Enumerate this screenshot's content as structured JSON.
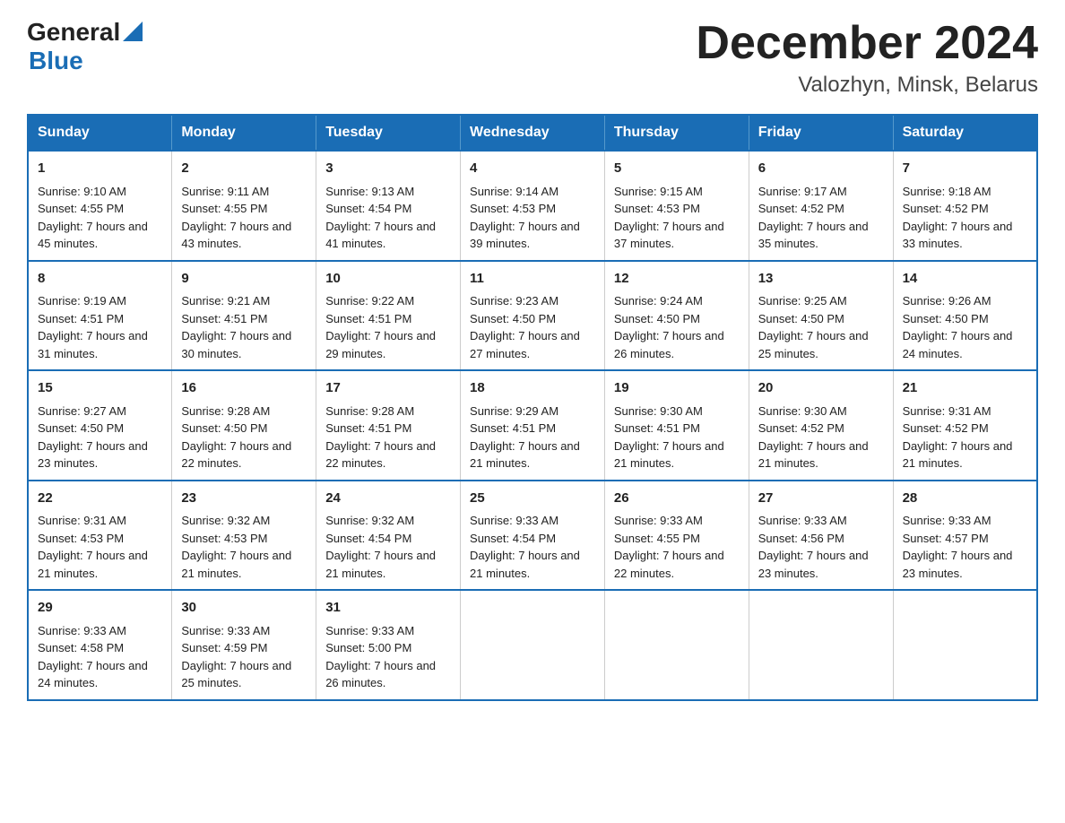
{
  "header": {
    "logo_general": "General",
    "logo_blue": "Blue",
    "month_title": "December 2024",
    "location": "Valozhyn, Minsk, Belarus"
  },
  "days_of_week": [
    "Sunday",
    "Monday",
    "Tuesday",
    "Wednesday",
    "Thursday",
    "Friday",
    "Saturday"
  ],
  "weeks": [
    [
      {
        "day": "1",
        "sunrise": "9:10 AM",
        "sunset": "4:55 PM",
        "daylight": "7 hours and 45 minutes."
      },
      {
        "day": "2",
        "sunrise": "9:11 AM",
        "sunset": "4:55 PM",
        "daylight": "7 hours and 43 minutes."
      },
      {
        "day": "3",
        "sunrise": "9:13 AM",
        "sunset": "4:54 PM",
        "daylight": "7 hours and 41 minutes."
      },
      {
        "day": "4",
        "sunrise": "9:14 AM",
        "sunset": "4:53 PM",
        "daylight": "7 hours and 39 minutes."
      },
      {
        "day": "5",
        "sunrise": "9:15 AM",
        "sunset": "4:53 PM",
        "daylight": "7 hours and 37 minutes."
      },
      {
        "day": "6",
        "sunrise": "9:17 AM",
        "sunset": "4:52 PM",
        "daylight": "7 hours and 35 minutes."
      },
      {
        "day": "7",
        "sunrise": "9:18 AM",
        "sunset": "4:52 PM",
        "daylight": "7 hours and 33 minutes."
      }
    ],
    [
      {
        "day": "8",
        "sunrise": "9:19 AM",
        "sunset": "4:51 PM",
        "daylight": "7 hours and 31 minutes."
      },
      {
        "day": "9",
        "sunrise": "9:21 AM",
        "sunset": "4:51 PM",
        "daylight": "7 hours and 30 minutes."
      },
      {
        "day": "10",
        "sunrise": "9:22 AM",
        "sunset": "4:51 PM",
        "daylight": "7 hours and 29 minutes."
      },
      {
        "day": "11",
        "sunrise": "9:23 AM",
        "sunset": "4:50 PM",
        "daylight": "7 hours and 27 minutes."
      },
      {
        "day": "12",
        "sunrise": "9:24 AM",
        "sunset": "4:50 PM",
        "daylight": "7 hours and 26 minutes."
      },
      {
        "day": "13",
        "sunrise": "9:25 AM",
        "sunset": "4:50 PM",
        "daylight": "7 hours and 25 minutes."
      },
      {
        "day": "14",
        "sunrise": "9:26 AM",
        "sunset": "4:50 PM",
        "daylight": "7 hours and 24 minutes."
      }
    ],
    [
      {
        "day": "15",
        "sunrise": "9:27 AM",
        "sunset": "4:50 PM",
        "daylight": "7 hours and 23 minutes."
      },
      {
        "day": "16",
        "sunrise": "9:28 AM",
        "sunset": "4:50 PM",
        "daylight": "7 hours and 22 minutes."
      },
      {
        "day": "17",
        "sunrise": "9:28 AM",
        "sunset": "4:51 PM",
        "daylight": "7 hours and 22 minutes."
      },
      {
        "day": "18",
        "sunrise": "9:29 AM",
        "sunset": "4:51 PM",
        "daylight": "7 hours and 21 minutes."
      },
      {
        "day": "19",
        "sunrise": "9:30 AM",
        "sunset": "4:51 PM",
        "daylight": "7 hours and 21 minutes."
      },
      {
        "day": "20",
        "sunrise": "9:30 AM",
        "sunset": "4:52 PM",
        "daylight": "7 hours and 21 minutes."
      },
      {
        "day": "21",
        "sunrise": "9:31 AM",
        "sunset": "4:52 PM",
        "daylight": "7 hours and 21 minutes."
      }
    ],
    [
      {
        "day": "22",
        "sunrise": "9:31 AM",
        "sunset": "4:53 PM",
        "daylight": "7 hours and 21 minutes."
      },
      {
        "day": "23",
        "sunrise": "9:32 AM",
        "sunset": "4:53 PM",
        "daylight": "7 hours and 21 minutes."
      },
      {
        "day": "24",
        "sunrise": "9:32 AM",
        "sunset": "4:54 PM",
        "daylight": "7 hours and 21 minutes."
      },
      {
        "day": "25",
        "sunrise": "9:33 AM",
        "sunset": "4:54 PM",
        "daylight": "7 hours and 21 minutes."
      },
      {
        "day": "26",
        "sunrise": "9:33 AM",
        "sunset": "4:55 PM",
        "daylight": "7 hours and 22 minutes."
      },
      {
        "day": "27",
        "sunrise": "9:33 AM",
        "sunset": "4:56 PM",
        "daylight": "7 hours and 23 minutes."
      },
      {
        "day": "28",
        "sunrise": "9:33 AM",
        "sunset": "4:57 PM",
        "daylight": "7 hours and 23 minutes."
      }
    ],
    [
      {
        "day": "29",
        "sunrise": "9:33 AM",
        "sunset": "4:58 PM",
        "daylight": "7 hours and 24 minutes."
      },
      {
        "day": "30",
        "sunrise": "9:33 AM",
        "sunset": "4:59 PM",
        "daylight": "7 hours and 25 minutes."
      },
      {
        "day": "31",
        "sunrise": "9:33 AM",
        "sunset": "5:00 PM",
        "daylight": "7 hours and 26 minutes."
      },
      null,
      null,
      null,
      null
    ]
  ]
}
